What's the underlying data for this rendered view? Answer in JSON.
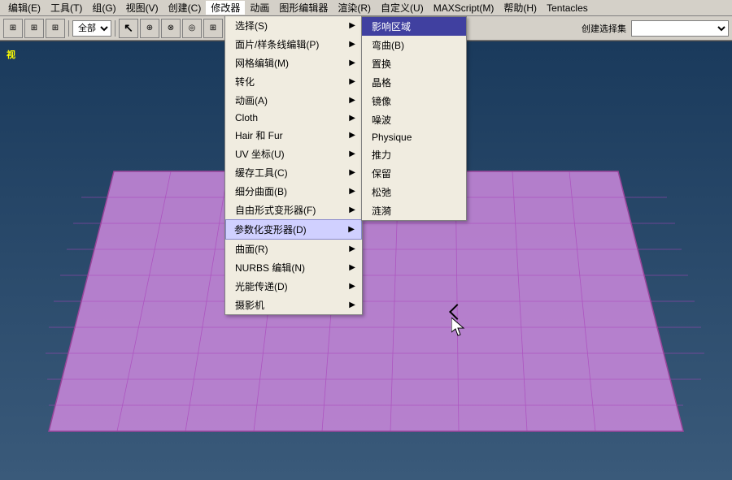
{
  "menubar": {
    "items": [
      {
        "label": "编辑(E)"
      },
      {
        "label": "工具(T)"
      },
      {
        "label": "组(G)"
      },
      {
        "label": "视图(V)"
      },
      {
        "label": "创建(C)"
      },
      {
        "label": "修改器",
        "active": true
      },
      {
        "label": "动画"
      },
      {
        "label": "图形编辑器"
      },
      {
        "label": "渲染(R)"
      },
      {
        "label": "自定义(U)"
      },
      {
        "label": "MAXScript(M)"
      },
      {
        "label": "帮助(H)"
      },
      {
        "label": "Tentacles"
      }
    ]
  },
  "toolbar": {
    "select_label": "全部",
    "buttons": [
      "⊞",
      "⊞",
      "⊞",
      "⊞",
      "⊞"
    ]
  },
  "viewport": {
    "label": "视"
  },
  "main_menu": {
    "items": [
      {
        "label": "选择(S)",
        "has_arrow": true
      },
      {
        "label": "面片/样条线编辑(P)",
        "has_arrow": true
      },
      {
        "label": "网格编辑(M)",
        "has_arrow": true
      },
      {
        "label": "转化",
        "has_arrow": true
      },
      {
        "label": "动画(A)",
        "has_arrow": true
      },
      {
        "label": "Cloth",
        "has_arrow": true
      },
      {
        "label": "Hair 和 Fur",
        "has_arrow": true
      },
      {
        "label": "UV 坐标(U)",
        "has_arrow": true
      },
      {
        "label": "缓存工具(C)",
        "has_arrow": true
      },
      {
        "label": "细分曲面(B)",
        "has_arrow": true
      },
      {
        "label": "自由形式变形器(F)",
        "has_arrow": true
      },
      {
        "label": "参数化变形器(D)",
        "has_arrow": true,
        "active": true
      },
      {
        "label": "曲面(R)",
        "has_arrow": true
      },
      {
        "label": "NURBS 编辑(N)",
        "has_arrow": true
      },
      {
        "label": "光能传递(D)",
        "has_arrow": true
      },
      {
        "label": "摄影机",
        "has_arrow": true
      }
    ]
  },
  "submenu": {
    "title": "参数化变形器(D)",
    "items": [
      {
        "label": "影响区域",
        "highlighted": true
      },
      {
        "label": "弯曲(B)"
      },
      {
        "label": "置换"
      },
      {
        "label": "晶格"
      },
      {
        "label": "镜像"
      },
      {
        "label": "噪波"
      },
      {
        "label": "Physique"
      },
      {
        "label": "推力"
      },
      {
        "label": "保留"
      },
      {
        "label": "松弛"
      },
      {
        "label": "涟漪"
      }
    ]
  },
  "colors": {
    "menu_bg": "#f0ece0",
    "menu_border": "#808080",
    "active_highlight": "#c8c8e8",
    "submenu_highlight": "#4040a0",
    "viewport_bg": "#2a4a6a",
    "grid_color": "#cc66cc",
    "grid_dark": "#aa44aa"
  }
}
